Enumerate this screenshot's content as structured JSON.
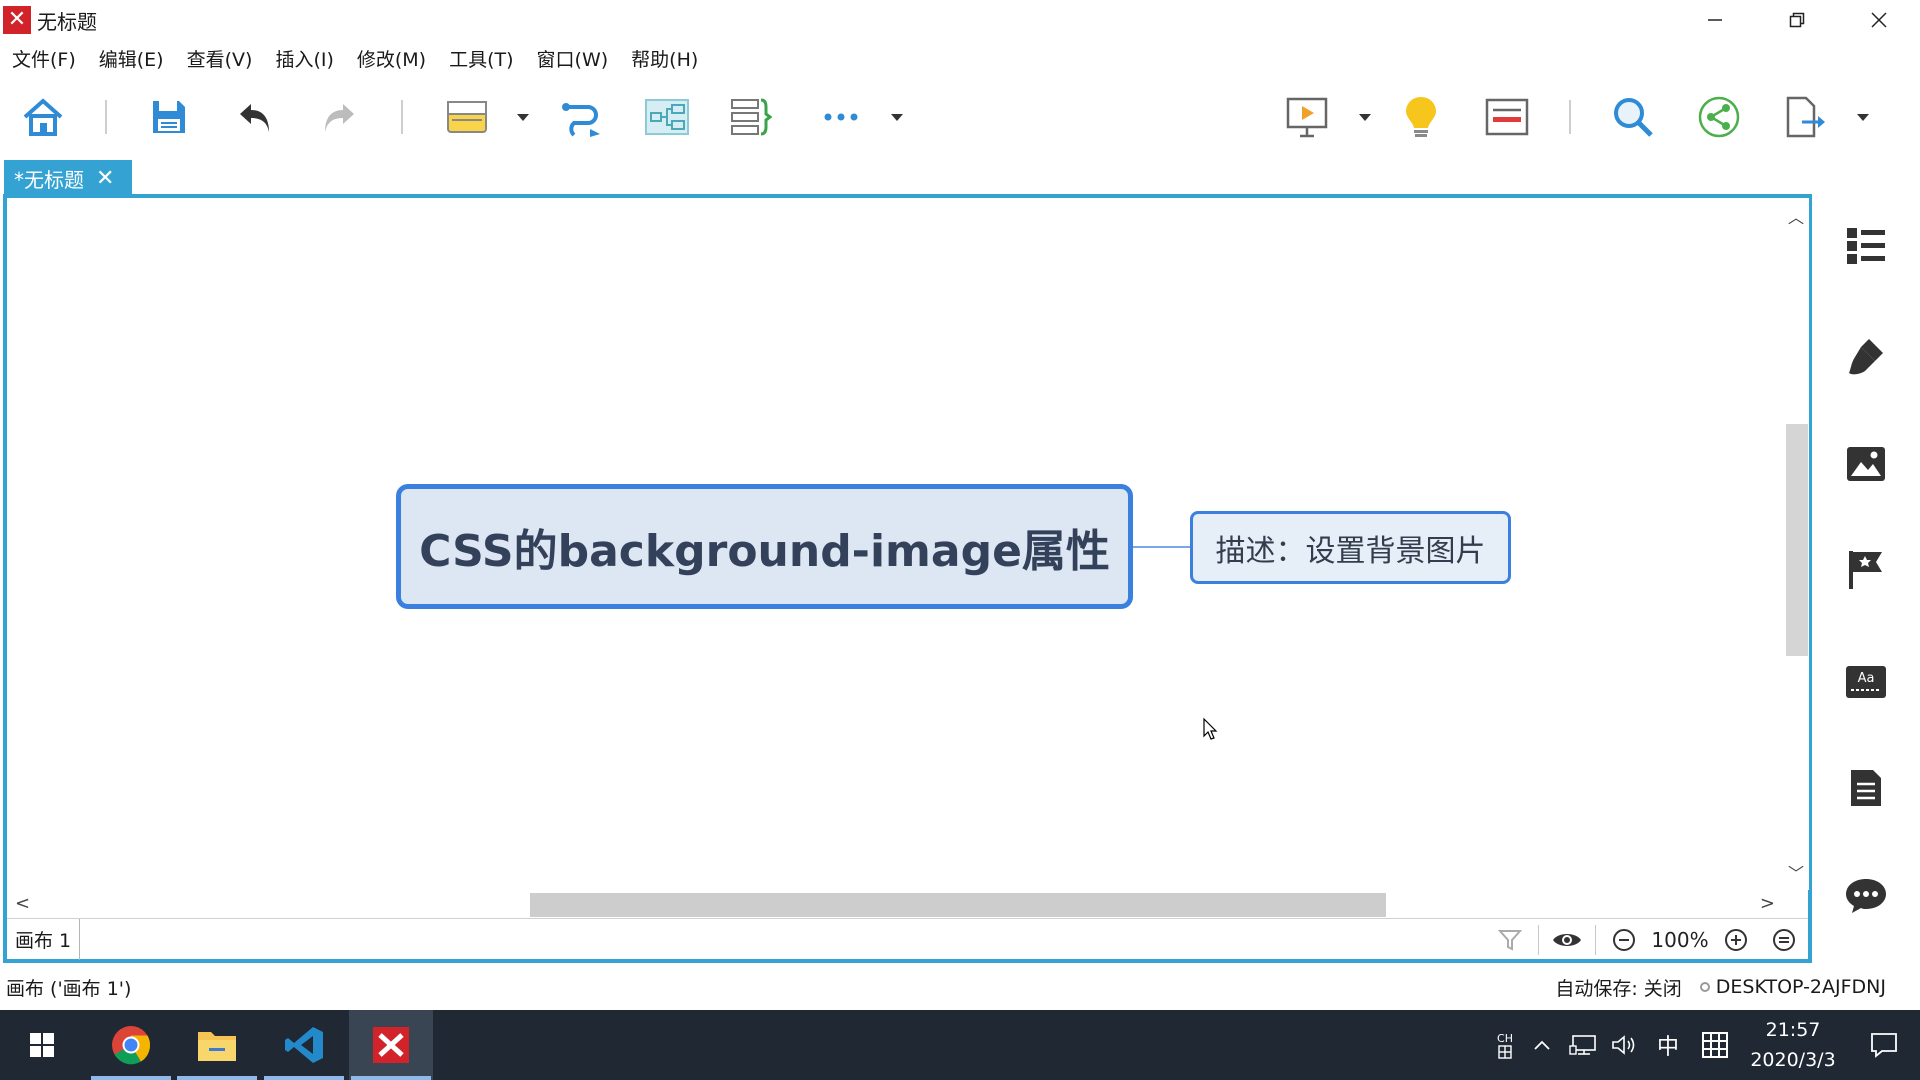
{
  "window": {
    "title": "无标题",
    "controls": [
      "minimize",
      "restore",
      "close"
    ]
  },
  "menu": {
    "items": [
      "文件(F)",
      "编辑(E)",
      "查看(V)",
      "插入(I)",
      "修改(M)",
      "工具(T)",
      "窗口(W)",
      "帮助(H)"
    ]
  },
  "toolbar": {
    "icons": [
      "home-icon",
      "save-icon",
      "undo-icon",
      "redo-icon",
      "insert-topic-icon",
      "relationship-icon",
      "structure-icon",
      "summary-icon",
      "more-icon",
      "presentation-icon",
      "idea-icon",
      "outline-icon",
      "search-icon",
      "share-icon",
      "export-icon"
    ]
  },
  "tab": {
    "label": "*无标题",
    "close": "✕"
  },
  "mindmap": {
    "central_topic": "CSS的background-image属性",
    "subtopic": "描述：设置背景图片"
  },
  "sheet": {
    "label": "画布 1"
  },
  "zoom": {
    "value": "100%"
  },
  "status": {
    "left": "画布 ('画布 1')",
    "autosave": "自动保存: 关闭",
    "machine": "DESKTOP-2AJFDNJ"
  },
  "right_panel": {
    "icons": [
      "outline-list-icon",
      "format-brush-icon",
      "image-icon",
      "marker-flag-icon",
      "text-style-icon",
      "notes-icon",
      "comment-icon"
    ]
  },
  "taskbar": {
    "apps": [
      "start-icon",
      "chrome-icon",
      "file-explorer-icon",
      "vscode-icon",
      "xmind-icon"
    ],
    "ime_small": "CH",
    "ime_lang": "中",
    "time": "21:57",
    "date": "2020/3/3"
  },
  "colors": {
    "accent": "#34a3d3",
    "topic_border": "#3b80df",
    "topic_fill": "#dde7f3",
    "taskbar": "#1f2833",
    "brand": "#d3232a"
  }
}
